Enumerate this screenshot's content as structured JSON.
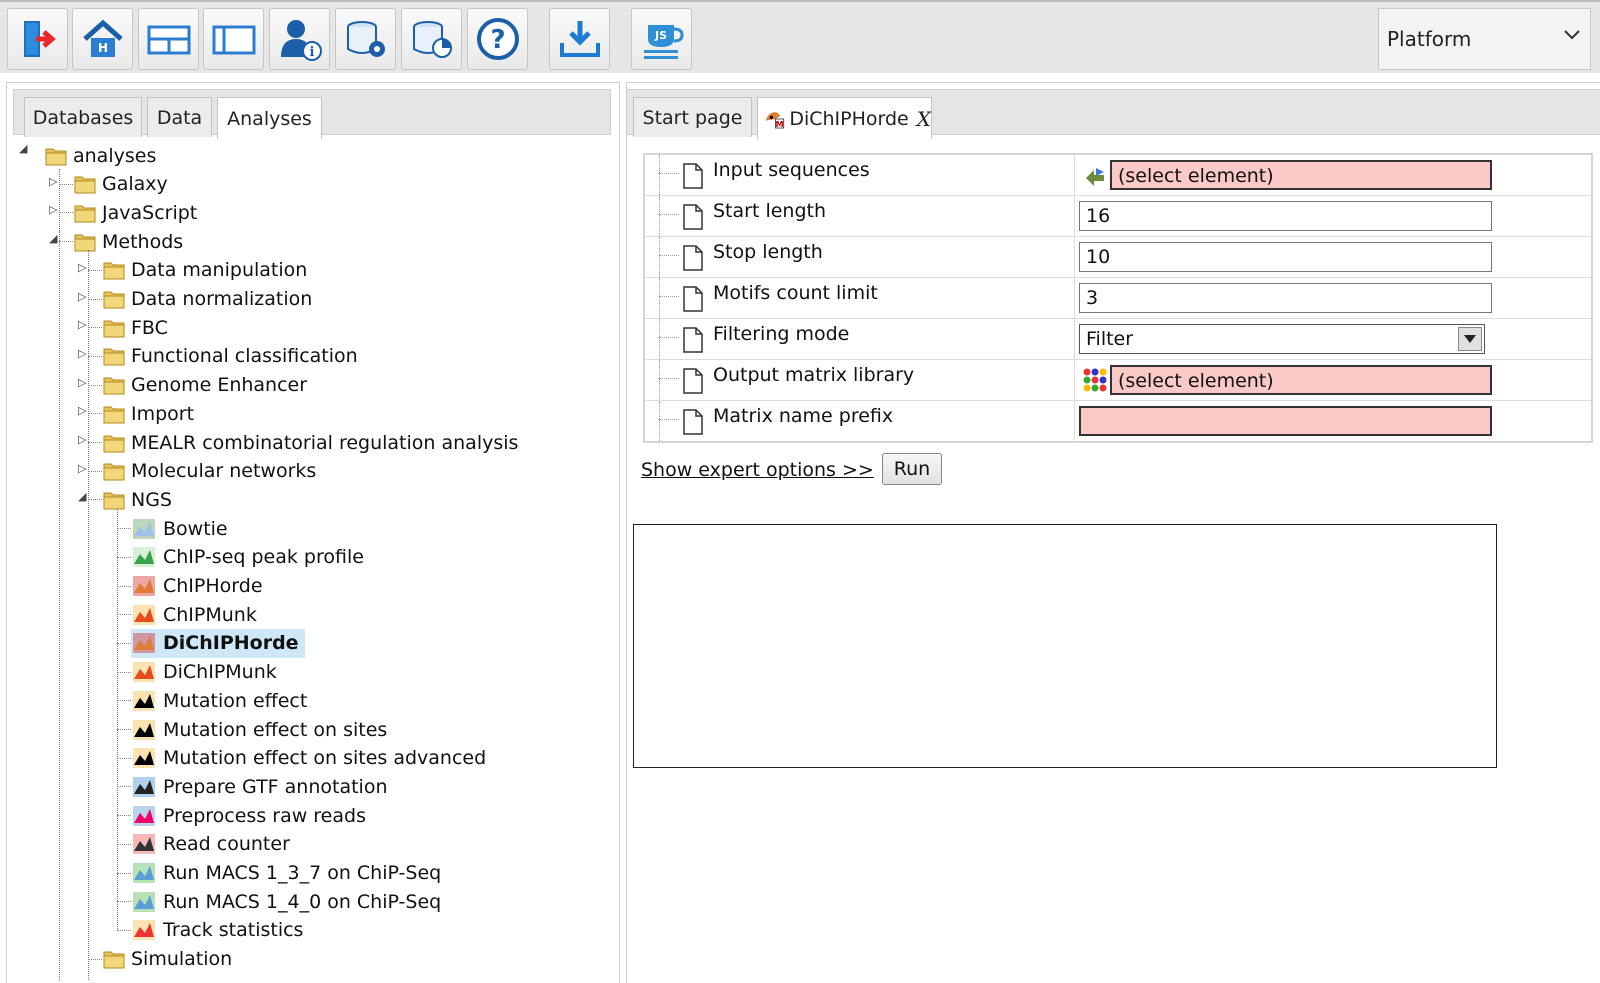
{
  "toolbar": {
    "buttons": [
      "exit-icon",
      "home-icon",
      "layout-icon",
      "panel-icon",
      "user-info-icon",
      "db-settings-icon",
      "db-chart-icon",
      "help-icon",
      "download-icon",
      "js-console-icon"
    ],
    "platform_label": "Platform"
  },
  "left": {
    "tabs": [
      "Databases",
      "Data",
      "Analyses"
    ],
    "active_tab": "Analyses",
    "tree": {
      "root": "analyses",
      "level1": [
        "Galaxy",
        "JavaScript",
        "Methods"
      ],
      "methods": [
        "Data manipulation",
        "Data normalization",
        "FBC",
        "Functional classification",
        "Genome Enhancer",
        "Import",
        "MEALR combinatorial regulation analysis",
        "Molecular networks",
        "NGS"
      ],
      "ngs": [
        "Bowtie",
        "ChIP-seq peak profile",
        "ChIPHorde",
        "ChIPMunk",
        "DiChIPHorde",
        "DiChIPMunk",
        "Mutation effect",
        "Mutation effect on sites",
        "Mutation effect on sites advanced",
        "Prepare GTF annotation",
        "Preprocess raw reads",
        "Read counter",
        "Run MACS 1_3_7 on ChiP-Seq",
        "Run MACS 1_4_0 on ChiP-Seq",
        "Track statistics"
      ],
      "partial": "Simulation",
      "selected": "DiChIPHorde"
    }
  },
  "right": {
    "tabs": [
      "Start page",
      "DiChIPHorde"
    ],
    "close_label": "X",
    "properties": [
      {
        "name": "Input sequences",
        "value": "(select element)",
        "kind": "element"
      },
      {
        "name": "Start length",
        "value": "16",
        "kind": "text"
      },
      {
        "name": "Stop length",
        "value": "10",
        "kind": "text"
      },
      {
        "name": "Motifs count limit",
        "value": "3",
        "kind": "text"
      },
      {
        "name": "Filtering mode",
        "value": "Filter",
        "kind": "select"
      },
      {
        "name": "Output matrix library",
        "value": "(select element)",
        "kind": "element"
      },
      {
        "name": "Matrix name prefix",
        "value": "",
        "kind": "required"
      }
    ],
    "expert_link": "Show expert options >>",
    "run_label": "Run"
  }
}
